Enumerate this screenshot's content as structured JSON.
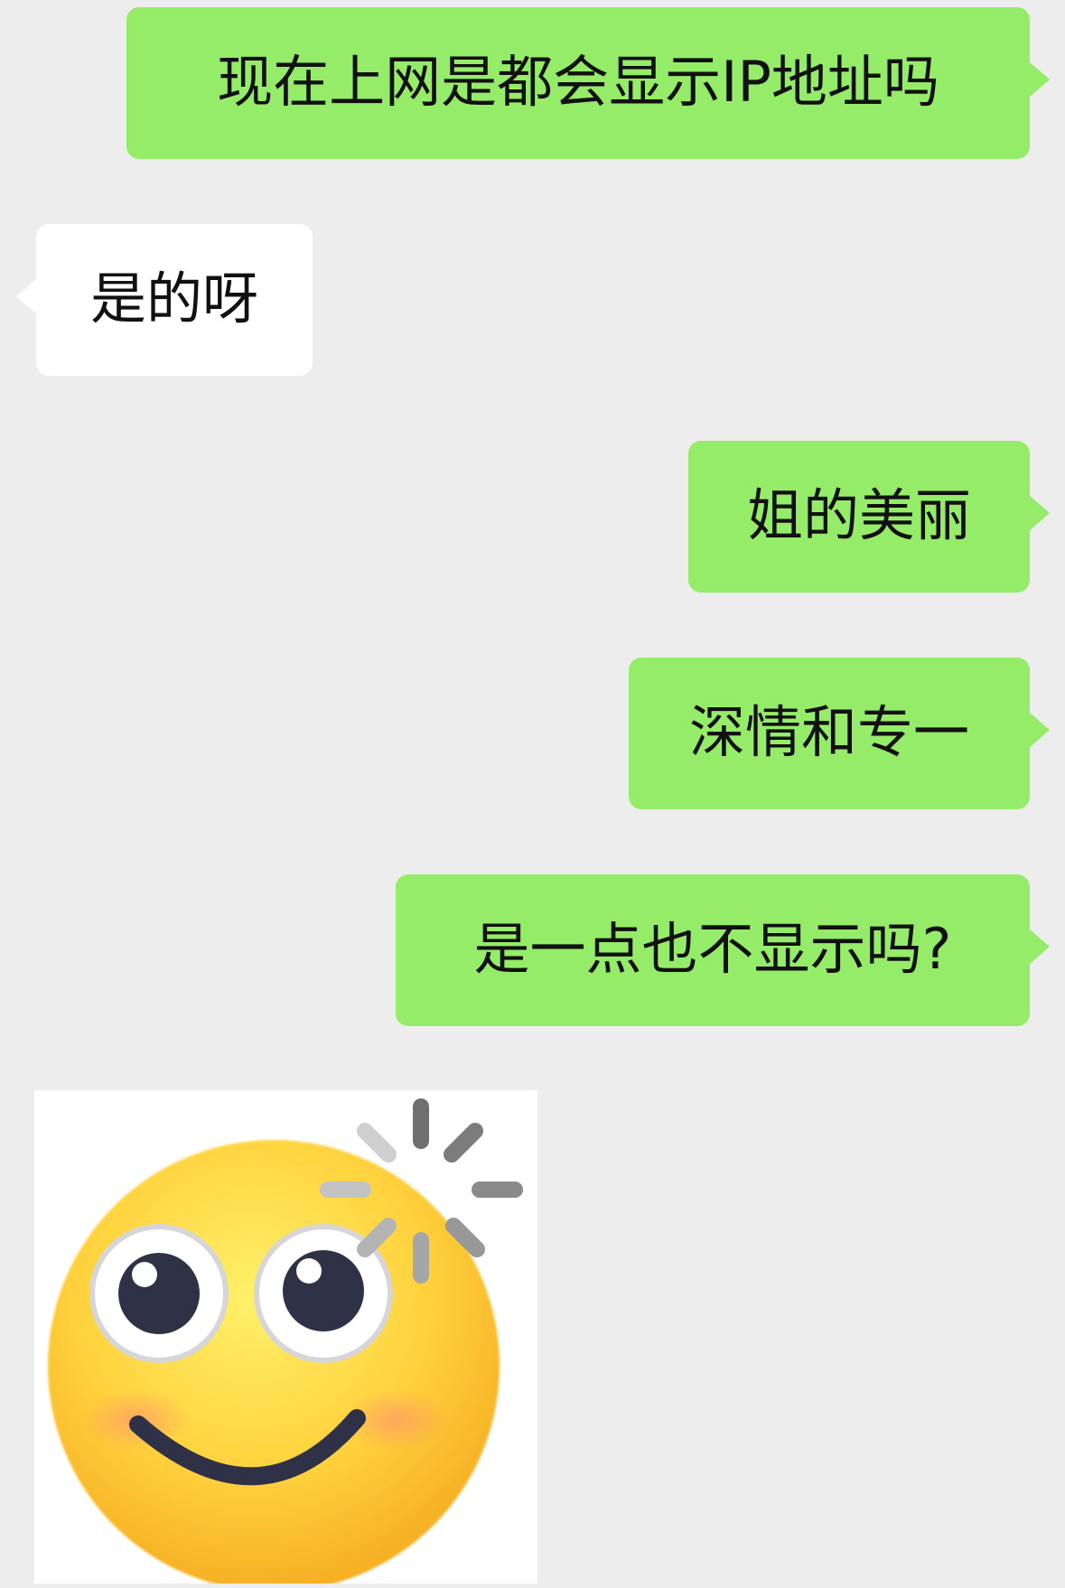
{
  "messages": [
    {
      "side": "sent",
      "text": "现在上网是都会显示IP地址吗"
    },
    {
      "side": "received",
      "text": "是的呀"
    },
    {
      "side": "sent",
      "text": "姐的美丽"
    },
    {
      "side": "sent",
      "text": "深情和专一"
    },
    {
      "side": "sent",
      "text": "是一点也不显示吗?"
    }
  ],
  "sticker": {
    "type": "emoji-sticker",
    "icon": "dizzy-smiling-face-icon",
    "sender_side": "received"
  },
  "colors": {
    "background": "#ededed",
    "sent_bubble": "#95ec69",
    "received_bubble": "#ffffff",
    "text": "#111111"
  }
}
